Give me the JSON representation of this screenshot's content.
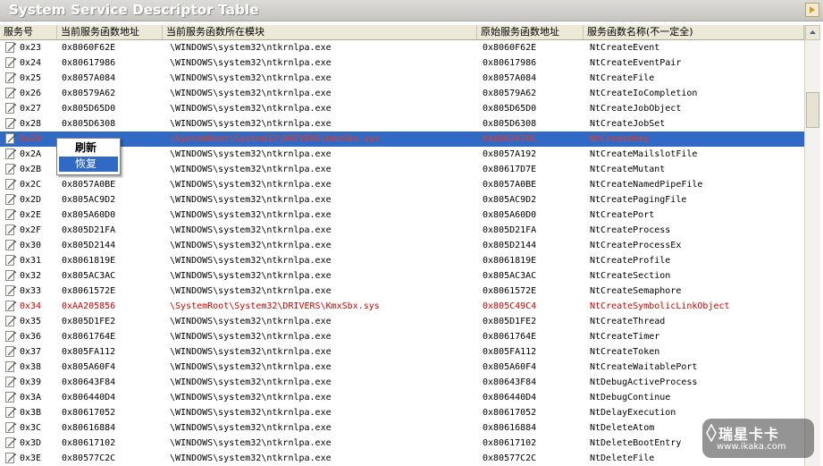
{
  "window": {
    "title": "System Service Descriptor Table"
  },
  "columns": [
    "服务号",
    "当前服务函数地址",
    "当前服务函数所在模块",
    "原始服务函数地址",
    "服务函数名称(不一定全)"
  ],
  "rows": [
    {
      "num": "0x23",
      "cur": "0x8060F62E",
      "module": "\\WINDOWS\\system32\\ntkrnlpa.exe",
      "orig": "0x8060F62E",
      "name": "NtCreateEvent",
      "state": "normal"
    },
    {
      "num": "0x24",
      "cur": "0x80617986",
      "module": "\\WINDOWS\\system32\\ntkrnlpa.exe",
      "orig": "0x80617986",
      "name": "NtCreateEventPair",
      "state": "normal"
    },
    {
      "num": "0x25",
      "cur": "0x8057A084",
      "module": "\\WINDOWS\\system32\\ntkrnlpa.exe",
      "orig": "0x8057A084",
      "name": "NtCreateFile",
      "state": "normal"
    },
    {
      "num": "0x26",
      "cur": "0x80579A62",
      "module": "\\WINDOWS\\system32\\ntkrnlpa.exe",
      "orig": "0x80579A62",
      "name": "NtCreateIoCompletion",
      "state": "normal"
    },
    {
      "num": "0x27",
      "cur": "0x805D65D0",
      "module": "\\WINDOWS\\system32\\ntkrnlpa.exe",
      "orig": "0x805D65D0",
      "name": "NtCreateJobObject",
      "state": "normal"
    },
    {
      "num": "0x28",
      "cur": "0x805D6308",
      "module": "\\WINDOWS\\system32\\ntkrnlpa.exe",
      "orig": "0x805D6308",
      "name": "NtCreateJobSet",
      "state": "normal"
    },
    {
      "num": "0x29",
      "cur": "",
      "module": "\\SystemRoot\\System32\\DRIVERS\\KmxSbx.sys",
      "orig": "0x8062478C",
      "name": "NtCreateKey",
      "state": "selected"
    },
    {
      "num": "0x2A",
      "cur": "",
      "module": "\\WINDOWS\\system32\\ntkrnlpa.exe",
      "orig": "0x8057A192",
      "name": "NtCreateMailslotFile",
      "state": "normal"
    },
    {
      "num": "0x2B",
      "cur": "",
      "module": "\\WINDOWS\\system32\\ntkrnlpa.exe",
      "orig": "0x80617D7E",
      "name": "NtCreateMutant",
      "state": "normal"
    },
    {
      "num": "0x2C",
      "cur": "0x8057A0BE",
      "module": "\\WINDOWS\\system32\\ntkrnlpa.exe",
      "orig": "0x8057A0BE",
      "name": "NtCreateNamedPipeFile",
      "state": "normal"
    },
    {
      "num": "0x2D",
      "cur": "0x805AC9D2",
      "module": "\\WINDOWS\\system32\\ntkrnlpa.exe",
      "orig": "0x805AC9D2",
      "name": "NtCreatePagingFile",
      "state": "normal"
    },
    {
      "num": "0x2E",
      "cur": "0x805A60D0",
      "module": "\\WINDOWS\\system32\\ntkrnlpa.exe",
      "orig": "0x805A60D0",
      "name": "NtCreatePort",
      "state": "normal"
    },
    {
      "num": "0x2F",
      "cur": "0x805D21FA",
      "module": "\\WINDOWS\\system32\\ntkrnlpa.exe",
      "orig": "0x805D21FA",
      "name": "NtCreateProcess",
      "state": "normal"
    },
    {
      "num": "0x30",
      "cur": "0x805D2144",
      "module": "\\WINDOWS\\system32\\ntkrnlpa.exe",
      "orig": "0x805D2144",
      "name": "NtCreateProcessEx",
      "state": "normal"
    },
    {
      "num": "0x31",
      "cur": "0x8061819E",
      "module": "\\WINDOWS\\system32\\ntkrnlpa.exe",
      "orig": "0x8061819E",
      "name": "NtCreateProfile",
      "state": "normal"
    },
    {
      "num": "0x32",
      "cur": "0x805AC3AC",
      "module": "\\WINDOWS\\system32\\ntkrnlpa.exe",
      "orig": "0x805AC3AC",
      "name": "NtCreateSection",
      "state": "normal"
    },
    {
      "num": "0x33",
      "cur": "0x8061572E",
      "module": "\\WINDOWS\\system32\\ntkrnlpa.exe",
      "orig": "0x8061572E",
      "name": "NtCreateSemaphore",
      "state": "normal"
    },
    {
      "num": "0x34",
      "cur": "0xAA205856",
      "module": "\\SystemRoot\\System32\\DRIVERS\\KmxSbx.sys",
      "orig": "0x805C49C4",
      "name": "NtCreateSymbolicLinkObject",
      "state": "hooked"
    },
    {
      "num": "0x35",
      "cur": "0x805D1FE2",
      "module": "\\WINDOWS\\system32\\ntkrnlpa.exe",
      "orig": "0x805D1FE2",
      "name": "NtCreateThread",
      "state": "normal"
    },
    {
      "num": "0x36",
      "cur": "0x8061764E",
      "module": "\\WINDOWS\\system32\\ntkrnlpa.exe",
      "orig": "0x8061764E",
      "name": "NtCreateTimer",
      "state": "normal"
    },
    {
      "num": "0x37",
      "cur": "0x805FA112",
      "module": "\\WINDOWS\\system32\\ntkrnlpa.exe",
      "orig": "0x805FA112",
      "name": "NtCreateToken",
      "state": "normal"
    },
    {
      "num": "0x38",
      "cur": "0x805A60F4",
      "module": "\\WINDOWS\\system32\\ntkrnlpa.exe",
      "orig": "0x805A60F4",
      "name": "NtCreateWaitablePort",
      "state": "normal"
    },
    {
      "num": "0x39",
      "cur": "0x80643F84",
      "module": "\\WINDOWS\\system32\\ntkrnlpa.exe",
      "orig": "0x80643F84",
      "name": "NtDebugActiveProcess",
      "state": "normal"
    },
    {
      "num": "0x3A",
      "cur": "0x806440D4",
      "module": "\\WINDOWS\\system32\\ntkrnlpa.exe",
      "orig": "0x806440D4",
      "name": "NtDebugContinue",
      "state": "normal"
    },
    {
      "num": "0x3B",
      "cur": "0x80617052",
      "module": "\\WINDOWS\\system32\\ntkrnlpa.exe",
      "orig": "0x80617052",
      "name": "NtDelayExecution",
      "state": "normal"
    },
    {
      "num": "0x3C",
      "cur": "0x80616884",
      "module": "\\WINDOWS\\system32\\ntkrnlpa.exe",
      "orig": "0x80616884",
      "name": "NtDeleteAtom",
      "state": "normal"
    },
    {
      "num": "0x3D",
      "cur": "0x80617102",
      "module": "\\WINDOWS\\system32\\ntkrnlpa.exe",
      "orig": "0x80617102",
      "name": "NtDeleteBootEntry",
      "state": "normal"
    },
    {
      "num": "0x3E",
      "cur": "0x80577C2C",
      "module": "\\WINDOWS\\system32\\ntkrnlpa.exe",
      "orig": "0x80577C2C",
      "name": "NtDeleteFile",
      "state": "normal"
    }
  ],
  "context_menu": {
    "items": [
      "刷新",
      "恢复"
    ],
    "highlighted": "恢复"
  },
  "watermark": {
    "line1": "瑞星卡卡",
    "line2": "www.ikaka.com"
  },
  "colors": {
    "selection": "#316ac5",
    "hooked_text": "#cc0000"
  },
  "icons": {
    "row_icon": "function-item-icon",
    "title_icon": "collapse-arrow-icon"
  }
}
